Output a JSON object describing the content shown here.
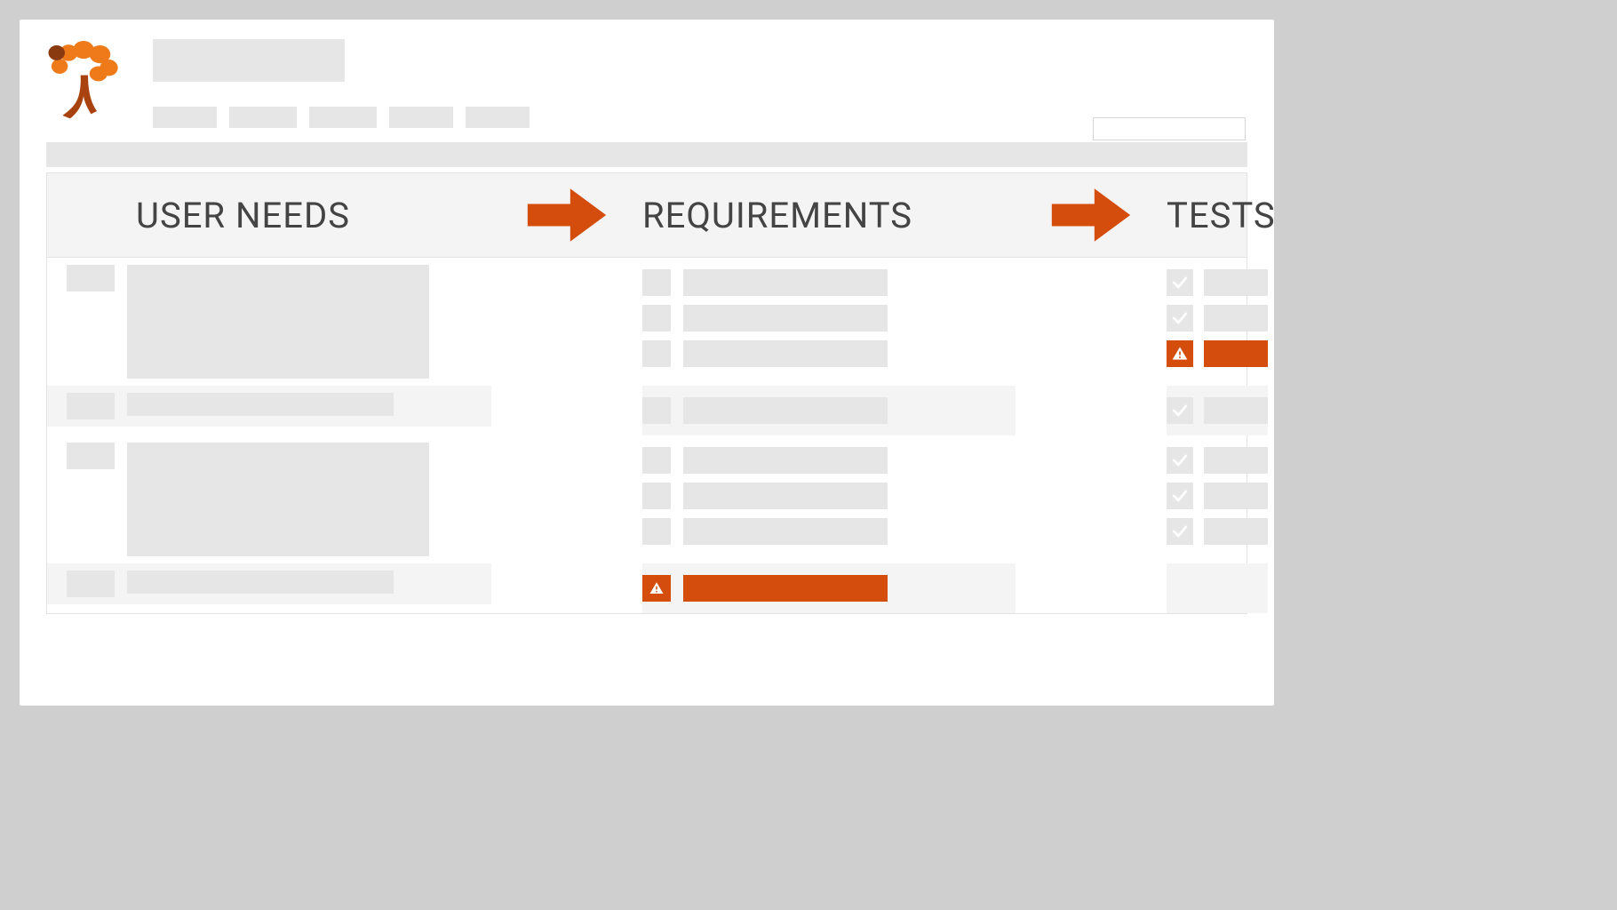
{
  "colors": {
    "accent": "#d44d0d",
    "placeholder": "#e6e6e6",
    "text": "#444"
  },
  "columns": {
    "user_needs": "USER NEEDS",
    "requirements": "REQUIREMENTS",
    "tests": "TESTS"
  },
  "icons": {
    "arrow": "arrow-right-icon",
    "check": "check-icon",
    "warn": "warning-triangle-icon",
    "logo": "tree-logo"
  },
  "groups": [
    {
      "alt": false,
      "user_need": {
        "type": "block"
      },
      "requirements": [
        {
          "status": "ok"
        },
        {
          "status": "ok"
        },
        {
          "status": "ok"
        }
      ],
      "tests": [
        {
          "status": "ok"
        },
        {
          "status": "ok"
        },
        {
          "status": "warn"
        }
      ]
    },
    {
      "alt": true,
      "user_need": {
        "type": "bar"
      },
      "requirements": [
        {
          "status": "ok"
        }
      ],
      "tests": [
        {
          "status": "ok"
        }
      ]
    },
    {
      "alt": false,
      "user_need": {
        "type": "block"
      },
      "requirements": [
        {
          "status": "ok"
        },
        {
          "status": "ok"
        },
        {
          "status": "ok"
        }
      ],
      "tests": [
        {
          "status": "ok"
        },
        {
          "status": "ok"
        },
        {
          "status": "ok"
        }
      ]
    },
    {
      "alt": true,
      "user_need": {
        "type": "bar"
      },
      "requirements": [
        {
          "status": "warn"
        }
      ],
      "tests": []
    }
  ]
}
